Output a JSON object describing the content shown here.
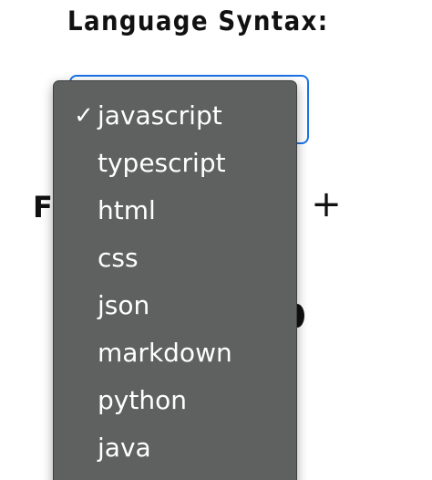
{
  "heading": "Language Syntax:",
  "font_label_partial": "F",
  "plus_label": "+",
  "dropdown": {
    "selected": "javascript",
    "check_glyph": "✓",
    "options": [
      "javascript",
      "typescript",
      "html",
      "css",
      "json",
      "markdown",
      "python",
      "java"
    ]
  }
}
